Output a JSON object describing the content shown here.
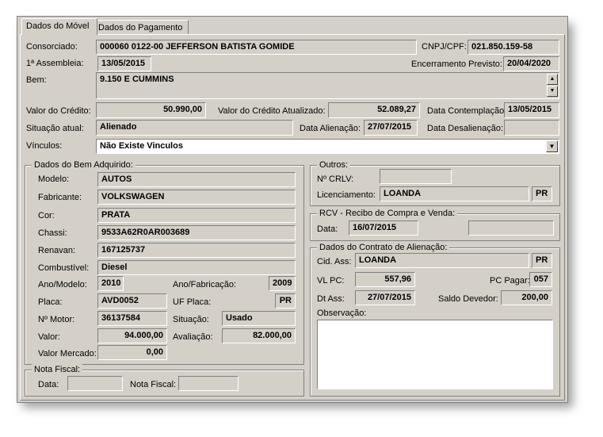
{
  "tabs": [
    "Dados do Móvel",
    "Dados do Pagamento"
  ],
  "labels": {
    "consorciado": "Consorciado:",
    "cnpj": "CNPJ/CPF:",
    "assembleia": "1ª Assembleia:",
    "encerramento": "Encerramento Previsto:",
    "bem": "Bem:",
    "valor_credito": "Valor do Crédito:",
    "valor_atualizado": "Valor do Crédito Atualizado:",
    "data_contemplacao": "Data Contemplação:",
    "situacao_atual": "Situação atual:",
    "data_alienacao": "Data Alienação:",
    "data_desalienacao": "Data Desalienação:",
    "vinculos": "Vínculos:"
  },
  "values": {
    "consorciado": "000060 0122-00  JEFFERSON BATISTA GOMIDE",
    "cnpj": "021.850.159-58",
    "assembleia": "13/05/2015",
    "encerramento": "20/04/2020",
    "bem": "9.150 E CUMMINS",
    "valor_credito": "50.990,00",
    "valor_atualizado": "52.089,27",
    "data_contemplacao": "13/05/2015",
    "situacao_atual": "Alienado",
    "data_alienacao": "27/07/2015",
    "data_desalienacao": "",
    "vinculos": "Não Existe Vinculos"
  },
  "bem_adquirido": {
    "title": "Dados do Bem Adquirido:",
    "labels": {
      "modelo": "Modelo:",
      "fabricante": "Fabricante:",
      "cor": "Cor:",
      "chassi": "Chassi:",
      "renavan": "Renavan:",
      "combustivel": "Combustível:",
      "ano_modelo": "Ano/Modelo:",
      "ano_fabricacao": "Ano/Fabricação:",
      "placa": "Placa:",
      "uf_placa": "UF Placa:",
      "motor": "Nº Motor:",
      "situacao": "Situação:",
      "valor": "Valor:",
      "avaliacao": "Avaliação:",
      "valor_mercado": "Valor Mercado:"
    },
    "values": {
      "modelo": "AUTOS",
      "fabricante": "VOLKSWAGEN",
      "cor": "PRATA",
      "chassi": "9533A62R0AR003689",
      "renavan": "167125737",
      "combustivel": "Diesel",
      "ano_modelo": "2010",
      "ano_fabricacao": "2009",
      "placa": "AVD0052",
      "uf_placa": "PR",
      "motor": "36137584",
      "situacao": "Usado",
      "valor": "94.000,00",
      "avaliacao": "82.000,00",
      "valor_mercado": "0,00"
    }
  },
  "nota_fiscal": {
    "title": "Nota Fiscal:",
    "labels": {
      "data": "Data:",
      "nota": "Nota Fiscal:"
    },
    "values": {
      "data": "",
      "nota": ""
    }
  },
  "outros": {
    "title": "Outros:",
    "labels": {
      "crlv": "Nº  CRLV:",
      "licenciamento": "Licenciamento:"
    },
    "values": {
      "crlv": "",
      "licenciamento": "LOANDA",
      "licenciamento_uf": "PR"
    }
  },
  "rcv": {
    "title": "RCV - Recibo de Compra e Venda:",
    "labels": {
      "data": "Data:"
    },
    "values": {
      "data": "16/07/2015",
      "extra": ""
    }
  },
  "contrato": {
    "title": "Dados do Contrato de Alienação:",
    "labels": {
      "cid_ass": "Cid. Ass:",
      "vl_pc": "VL PC:",
      "pc_pagar": "PC Pagar:",
      "dt_ass": "Dt Ass:",
      "saldo": "Saldo Devedor:",
      "observacao": "Observação:"
    },
    "values": {
      "cid_ass": "LOANDA",
      "cid_uf": "PR",
      "vl_pc": "557,96",
      "pc_pagar": "057",
      "dt_ass": "27/07/2015",
      "saldo": "200,00",
      "observacao": ""
    }
  },
  "icons": {
    "scroll_up": "▲",
    "scroll_down": "▼",
    "dropdown": "▼"
  }
}
